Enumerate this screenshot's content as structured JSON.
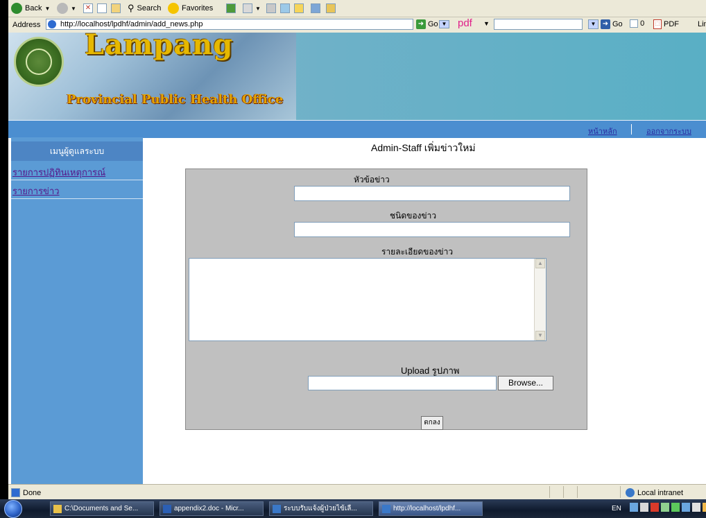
{
  "toolbar": {
    "back_label": "Back",
    "search_label": "Search",
    "favorites_label": "Favorites"
  },
  "addressbar": {
    "label": "Address",
    "url": "http://localhost/lpdhf/admin/add_news.php",
    "go_label": "Go",
    "pdf_word": "pdf",
    "go2_label": "Go",
    "counter": "0",
    "pdf_button": "PDF",
    "links_label": "Lin"
  },
  "banner": {
    "title": "Lampang",
    "subtitle": "Provincial Public Health Office"
  },
  "nav": {
    "home": "หน้าหลัก",
    "logout": "ออกจากระบบ"
  },
  "sidebar": {
    "header": "เมนูผู้ดูแลระบบ",
    "items": [
      {
        "label": "รายการปฏิทินเหตุการณ์"
      },
      {
        "label": "รายการข่าว"
      }
    ]
  },
  "main": {
    "title": "Admin-Staff เพิ่มข่าวใหม่",
    "form": {
      "headline_label": "หัวข้อข่าว",
      "type_label": "ชนิดของข่าว",
      "detail_label": "รายละเอียดของข่าว",
      "upload_label": "Upload รูปภาพ",
      "browse_label": "Browse...",
      "submit_label": "ตกลง"
    }
  },
  "status": {
    "left": "Done",
    "zone": "Local intranet"
  },
  "taskbar": {
    "items": [
      {
        "label": "C:\\Documents and Se..."
      },
      {
        "label": "appendix2.doc - Micr..."
      },
      {
        "label": "ระบบรับแจ้งผู้ป่วยไข้เลื..."
      },
      {
        "label": "http://localhost/lpdhf..."
      }
    ],
    "lang": "EN"
  },
  "colors": {
    "nav_bar": "#4b8ed0",
    "sidebar": "#5b9bd5",
    "form_panel": "#c0c0c0",
    "title_gold": "#e6b800"
  }
}
